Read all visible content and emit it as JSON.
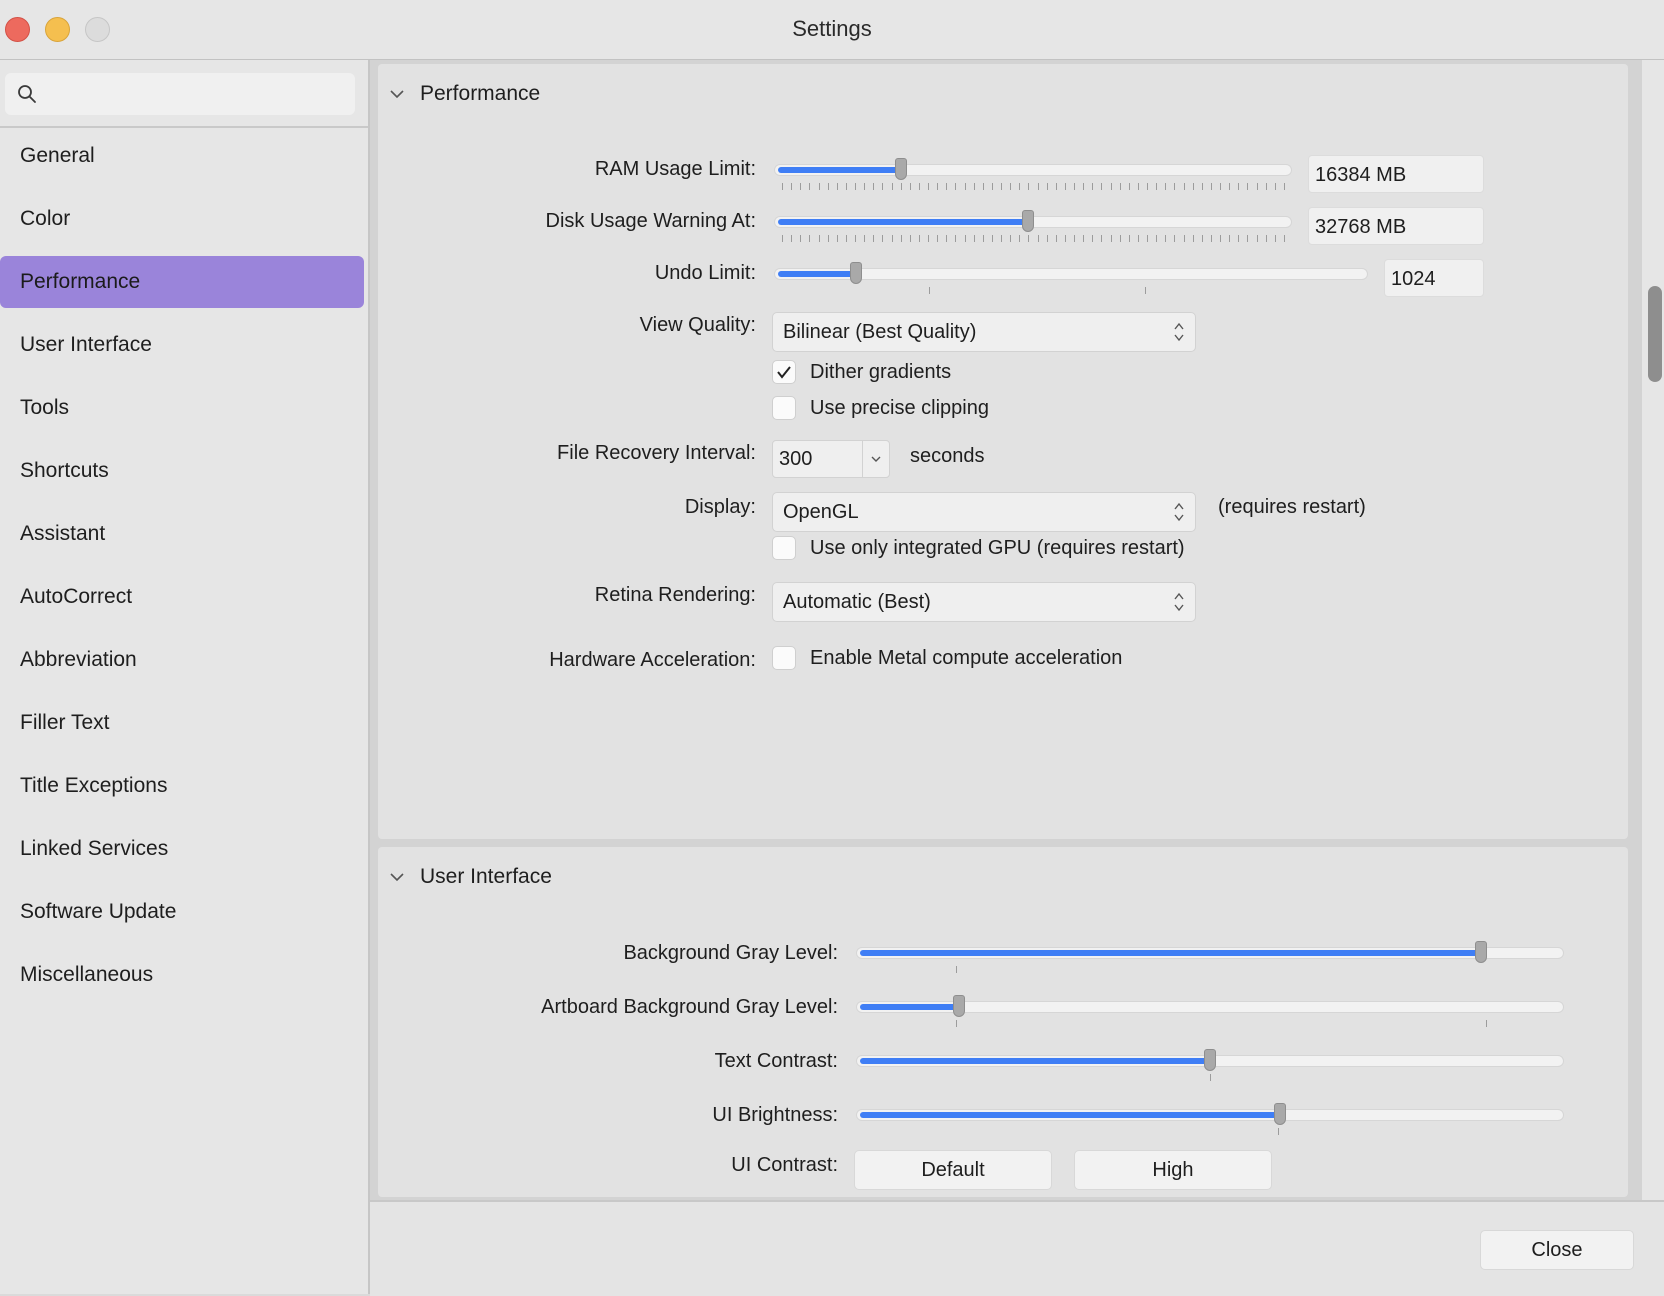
{
  "window": {
    "title": "Settings"
  },
  "search": {
    "placeholder": "",
    "value": ""
  },
  "sidebar": {
    "items": [
      {
        "label": "General"
      },
      {
        "label": "Color"
      },
      {
        "label": "Performance",
        "active": true
      },
      {
        "label": "User Interface"
      },
      {
        "label": "Tools"
      },
      {
        "label": "Shortcuts"
      },
      {
        "label": "Assistant"
      },
      {
        "label": "AutoCorrect"
      },
      {
        "label": "Abbreviation"
      },
      {
        "label": "Filler Text"
      },
      {
        "label": "Title Exceptions"
      },
      {
        "label": "Linked Services"
      },
      {
        "label": "Software Update"
      },
      {
        "label": "Miscellaneous"
      }
    ]
  },
  "performance": {
    "title": "Performance",
    "ram": {
      "label": "RAM Usage Limit:",
      "value": "16384 MB",
      "level": 0.24
    },
    "disk": {
      "label": "Disk Usage Warning At:",
      "value": "32768 MB",
      "level": 0.49
    },
    "undo": {
      "label": "Undo Limit:",
      "value": "1024",
      "level": 0.13
    },
    "view_quality": {
      "label": "View Quality:",
      "value": "Bilinear (Best Quality)"
    },
    "dither": {
      "label": "Dither gradients",
      "checked": true
    },
    "precise_clipping": {
      "label": "Use precise clipping",
      "checked": false
    },
    "file_recovery": {
      "label": "File Recovery Interval:",
      "value": "300",
      "unit": "seconds"
    },
    "display": {
      "label": "Display:",
      "value": "OpenGL",
      "note": "(requires restart)"
    },
    "integrated_gpu": {
      "label": "Use only integrated GPU (requires restart)",
      "checked": false
    },
    "retina": {
      "label": "Retina Rendering:",
      "value": "Automatic (Best)"
    },
    "hardware": {
      "label": "Hardware Acceleration:",
      "checkbox_label": "Enable Metal compute acceleration",
      "checked": false
    }
  },
  "user_interface": {
    "title": "User Interface",
    "background_gray": {
      "label": "Background Gray Level:",
      "level": 0.89
    },
    "artboard_gray": {
      "label": "Artboard Background Gray Level:",
      "level": 0.14
    },
    "text_contrast": {
      "label": "Text Contrast:",
      "level": 0.5
    },
    "ui_brightness": {
      "label": "UI Brightness:",
      "level": 0.6
    },
    "ui_contrast": {
      "label": "UI Contrast:",
      "default_label": "Default",
      "high_label": "High"
    }
  },
  "footer": {
    "close_label": "Close"
  },
  "colors": {
    "accent": "#3f7ef5",
    "sidebar_selection": "#9a84da"
  }
}
